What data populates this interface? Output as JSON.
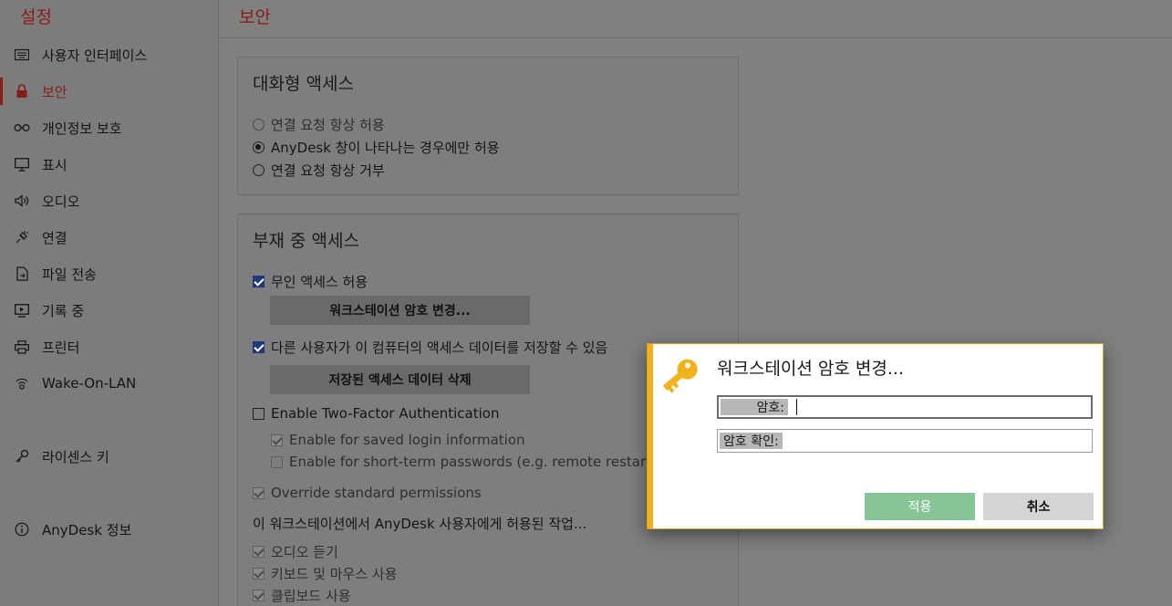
{
  "sidebar": {
    "title": "설정",
    "items": [
      {
        "label": "사용자 인터페이스",
        "icon": "keyboard-icon"
      },
      {
        "label": "보안",
        "icon": "lock-icon",
        "active": true
      },
      {
        "label": "개인정보 보호",
        "icon": "glasses-icon"
      },
      {
        "label": "표시",
        "icon": "monitor-icon"
      },
      {
        "label": "오디오",
        "icon": "speaker-icon"
      },
      {
        "label": "연결",
        "icon": "plug-icon"
      },
      {
        "label": "파일 전송",
        "icon": "file-transfer-icon"
      },
      {
        "label": "기록 중",
        "icon": "record-icon"
      },
      {
        "label": "프린터",
        "icon": "printer-icon"
      },
      {
        "label": "Wake-On-LAN",
        "icon": "wake-on-lan-icon"
      },
      {
        "label": "라이센스 키",
        "icon": "key-icon"
      },
      {
        "label": "AnyDesk 정보",
        "icon": "info-icon"
      }
    ]
  },
  "header": {
    "title": "보안"
  },
  "interactive_access": {
    "title": "대화형 액세스",
    "options": [
      {
        "label": "연결 요청 항상 허용",
        "selected": false
      },
      {
        "label": "AnyDesk 창이 나타나는 경우에만 허용",
        "selected": true
      },
      {
        "label": "연결 요청 항상 거부",
        "selected": false
      }
    ]
  },
  "unattended_access": {
    "title": "부재 중 액세스",
    "allow_unattended": "무인 액세스 허용",
    "change_password_button": "워크스테이션 암호 변경...",
    "allow_store_data": "다른 사용자가 이 컴퓨터의 액세스 데이터를 저장할 수 있음",
    "delete_data_button": "저장된 액세스 데이터 삭제",
    "two_factor": "Enable Two-Factor Authentication",
    "saved_login": "Enable for saved login information",
    "short_term": "Enable for short-term passwords (e.g. remote restart)",
    "override_permissions": "Override standard permissions",
    "permissions_heading": "이 워크스테이션에서 AnyDesk 사용자에게 허용된 작업...",
    "permissions": [
      "오디오 듣기",
      "키보드 및 마우스 사용",
      "클립보드 사용"
    ]
  },
  "dialog": {
    "title": "워크스테이션 암호 변경...",
    "password_label": "암호:",
    "password_value": "",
    "confirm_label": "암호 확인:",
    "confirm_value": "",
    "apply_label": "적용",
    "cancel_label": "취소",
    "accent_color": "#f2b21b",
    "apply_color": "#86c596"
  },
  "colors": {
    "brand_red": "#8a1c1c",
    "checkbox_blue": "#1f3a78"
  }
}
